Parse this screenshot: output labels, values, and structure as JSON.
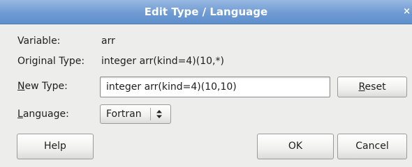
{
  "dialog": {
    "title": "Edit Type / Language",
    "close_glyph": "×"
  },
  "variable": {
    "label": "Variable:",
    "value": "arr"
  },
  "original_type": {
    "label": "Original Type:",
    "value": "integer arr(kind=4)(10,*)"
  },
  "new_type": {
    "label_mnemonic": "N",
    "label_rest": "ew Type:",
    "value": "integer arr(kind=4)(10,10)"
  },
  "reset_button": {
    "mnemonic": "R",
    "rest": "eset"
  },
  "language": {
    "label_mnemonic": "L",
    "label_rest": "anguage:",
    "selected": "Fortran",
    "icon": "updown-arrows-icon"
  },
  "buttons": {
    "help": "Help",
    "ok": "OK",
    "cancel": "Cancel"
  },
  "colors": {
    "titlebar": "#6f9bd3",
    "background": "#ededeb"
  }
}
